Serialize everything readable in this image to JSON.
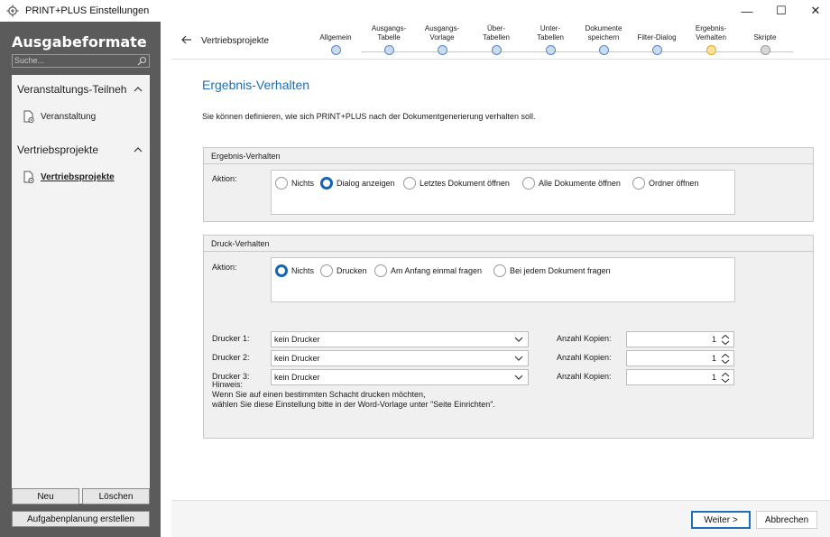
{
  "window": {
    "title": "PRINT+PLUS Einstellungen",
    "minimize": "—",
    "maximize": "☐",
    "close": "✕"
  },
  "sidebar": {
    "heading": "Ausgabeformate",
    "search_placeholder": "Suche...",
    "sections": [
      {
        "label": "Veranstaltungs-Teilneh",
        "items": [
          {
            "label": "Veranstaltung",
            "active": false
          }
        ]
      },
      {
        "label": "Vertriebsprojekte",
        "items": [
          {
            "label": "Vertriebsprojekte",
            "active": true
          }
        ]
      }
    ],
    "buttons": {
      "new": "Neu",
      "delete": "Löschen",
      "schedule": "Aufgabenplanung erstellen"
    }
  },
  "wizard": {
    "breadcrumb": "Vertriebsprojekte",
    "steps": [
      {
        "label": "Allgemein",
        "state": "done"
      },
      {
        "label": "Ausgangs-\nTabelle",
        "state": "done"
      },
      {
        "label": "Ausgangs-\nVorlage",
        "state": "done"
      },
      {
        "label": "Über-\nTabellen",
        "state": "done"
      },
      {
        "label": "Unter-\nTabellen",
        "state": "done"
      },
      {
        "label": "Dokumente\nspeichern",
        "state": "done"
      },
      {
        "label": "Filter-Dialog",
        "state": "done"
      },
      {
        "label": "Ergebnis-\nVerhalten",
        "state": "current"
      },
      {
        "label": "Skripte",
        "state": "future"
      }
    ]
  },
  "main": {
    "title": "Ergebnis-Verhalten",
    "intro": "Sie können definieren, wie sich PRINT+PLUS nach der Dokumentgenerierung verhalten soll.",
    "result_group": {
      "title": "Ergebnis-Verhalten",
      "action_label": "Aktion:",
      "options": [
        "Nichts",
        "Dialog anzeigen",
        "Letztes Dokument öffnen",
        "Alle Dokumente öffnen",
        "Ordner öffnen"
      ],
      "selected": "Dialog anzeigen"
    },
    "print_group": {
      "title": "Druck-Verhalten",
      "action_label": "Aktion:",
      "options": [
        "Nichts",
        "Drucken",
        "Am Anfang einmal fragen",
        "Bei jedem Dokument fragen"
      ],
      "selected": "Nichts",
      "printers": [
        {
          "label": "Drucker 1:",
          "value": "kein Drucker",
          "copies_label": "Anzahl Kopien:",
          "copies": "1"
        },
        {
          "label": "Drucker 2:",
          "value": "kein Drucker",
          "copies_label": "Anzahl Kopien:",
          "copies": "1"
        },
        {
          "label": "Drucker 3:",
          "value": "kein Drucker",
          "copies_label": "Anzahl Kopien:",
          "copies": "1"
        }
      ],
      "note_title": "Hinweis:",
      "note_line1": "Wenn Sie auf einen bestimmten Schacht drucken möchten,",
      "note_line2": "wählen Sie diese Einstellung bitte in der Word-Vorlage unter \"Seite Einrichten\"."
    }
  },
  "footer": {
    "next": "Weiter >",
    "cancel": "Abbrechen"
  },
  "colors": {
    "accent": "#1f6fb8",
    "sidebar_bg": "#5b5b5b",
    "group_bg": "#f0f0f0"
  }
}
